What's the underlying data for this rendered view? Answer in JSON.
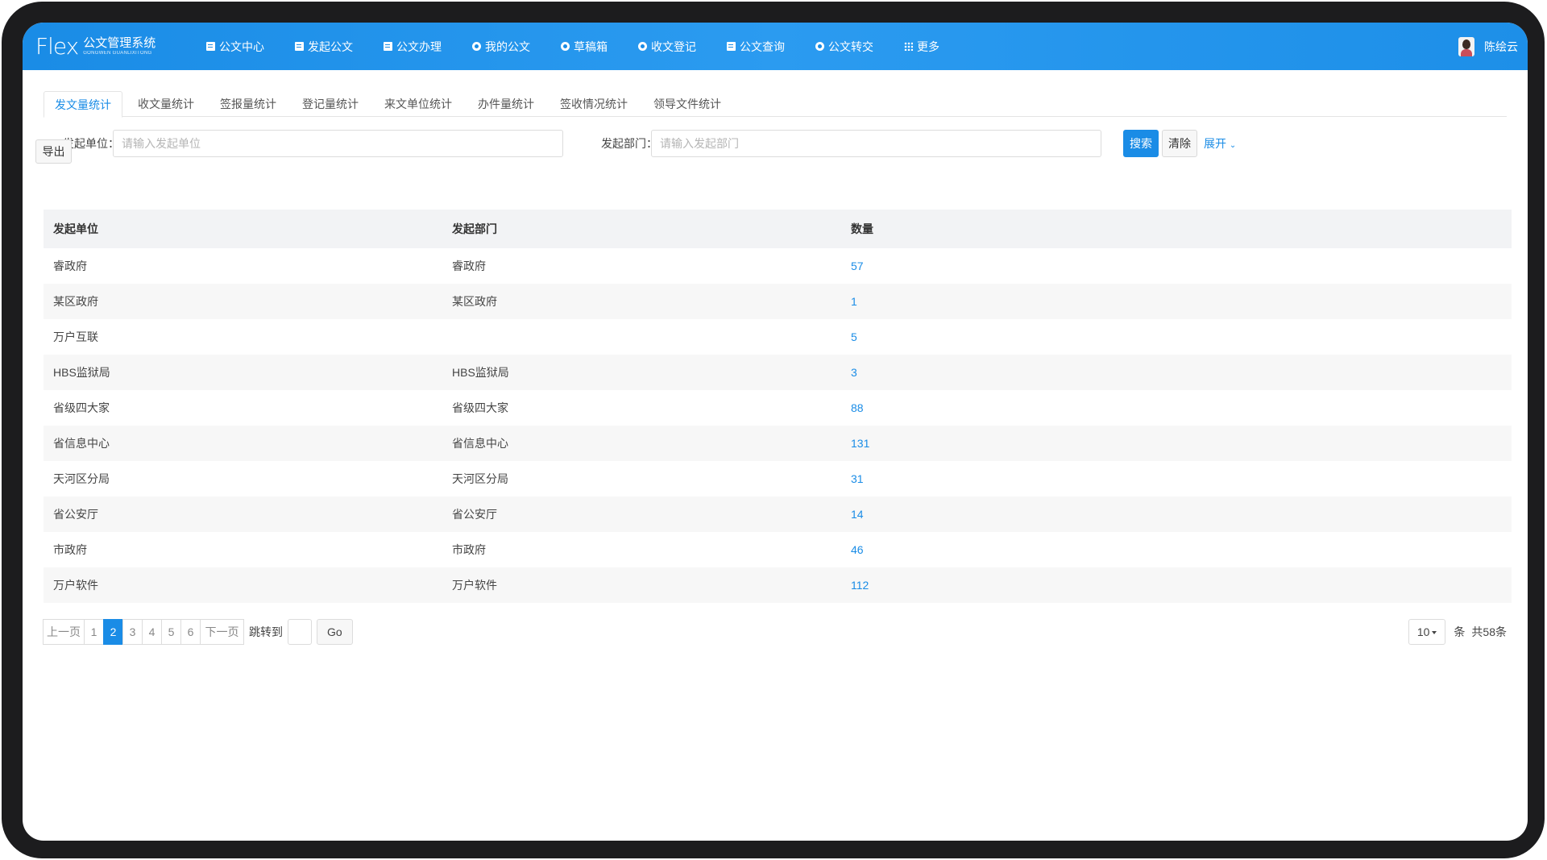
{
  "app": {
    "logo_mark": "Flex",
    "logo_cn": "公文管理系统",
    "logo_en": "GONGWEN GUANLIXITONG"
  },
  "nav": [
    {
      "label": "公文中心",
      "icon": "document-icon"
    },
    {
      "label": "发起公文",
      "icon": "save-icon"
    },
    {
      "label": "公文办理",
      "icon": "inbox-icon"
    },
    {
      "label": "我的公文",
      "icon": "circle-icon"
    },
    {
      "label": "草稿箱",
      "icon": "circle-icon"
    },
    {
      "label": "收文登记",
      "icon": "circle-icon"
    },
    {
      "label": "公文查询",
      "icon": "edit-icon"
    },
    {
      "label": "公文转交",
      "icon": "circle-icon"
    },
    {
      "label": "更多",
      "icon": "grid-icon"
    }
  ],
  "user": {
    "name": "陈绘云"
  },
  "tabs": [
    {
      "label": "发文量统计",
      "active": true
    },
    {
      "label": "收文量统计"
    },
    {
      "label": "签报量统计"
    },
    {
      "label": "登记量统计"
    },
    {
      "label": "来文单位统计"
    },
    {
      "label": "办件量统计"
    },
    {
      "label": "签收情况统计"
    },
    {
      "label": "领导文件统计"
    }
  ],
  "search": {
    "unit_label": "发起单位：",
    "unit_placeholder": "请输入发起单位",
    "dept_label": "发起部门：",
    "dept_placeholder": "请输入发起部门",
    "search_btn": "搜索",
    "clear_btn": "清除",
    "expand": "展开"
  },
  "export_btn": "导出",
  "table": {
    "headers": [
      "发起单位",
      "发起部门",
      "数量"
    ],
    "rows": [
      [
        "睿政府",
        "睿政府",
        "57"
      ],
      [
        "某区政府",
        "某区政府",
        "1"
      ],
      [
        "万户互联",
        "",
        "5"
      ],
      [
        "HBS监狱局",
        "HBS监狱局",
        "3"
      ],
      [
        "省级四大家",
        "省级四大家",
        "88"
      ],
      [
        "省信息中心",
        "省信息中心",
        "131"
      ],
      [
        "天河区分局",
        "天河区分局",
        "31"
      ],
      [
        "省公安厅",
        "省公安厅",
        "14"
      ],
      [
        "市政府",
        "市政府",
        "46"
      ],
      [
        "万户软件",
        "万户软件",
        "112"
      ]
    ]
  },
  "pagination": {
    "prev": "上一页",
    "pages": [
      "1",
      "2",
      "3",
      "4",
      "5",
      "6"
    ],
    "current": "2",
    "next": "下一页",
    "jump_label": "跳转到",
    "go": "Go",
    "page_size": "10",
    "unit": "条",
    "total": "共58条"
  },
  "colors": {
    "accent": "#1a8ce6",
    "stripe": "#f7f7f7",
    "header_bg": "#f2f3f5"
  }
}
